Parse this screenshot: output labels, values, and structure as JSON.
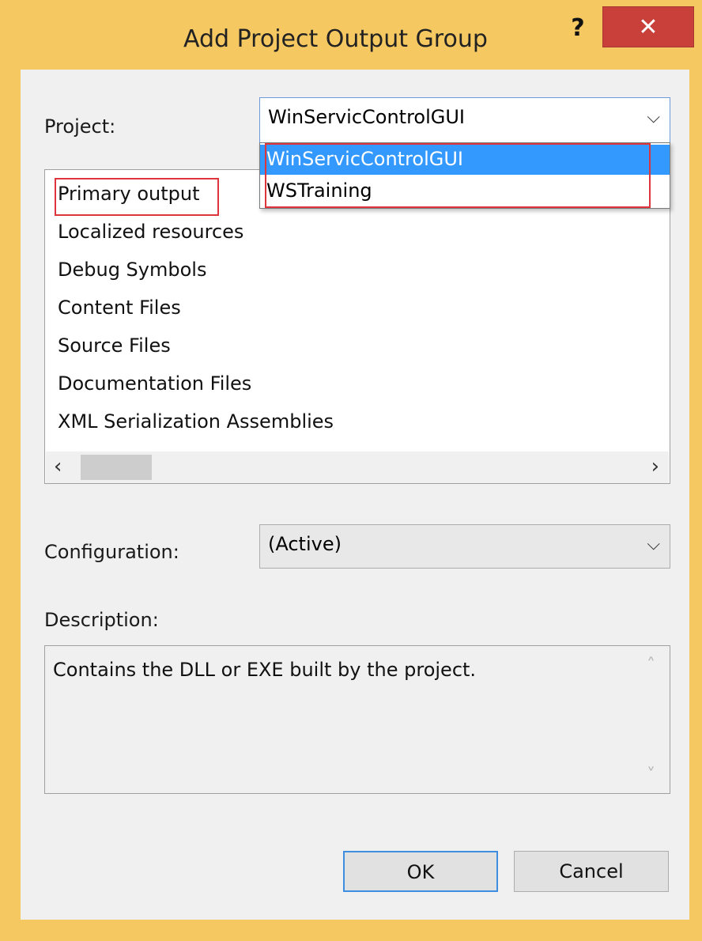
{
  "window": {
    "title": "Add Project Output Group",
    "help_label": "?",
    "close_label": "✕"
  },
  "project": {
    "label": "Project:",
    "selected": "WinServicControlGUI",
    "options": [
      "WinServicControlGUI",
      "WSTraining"
    ],
    "highlighted_index": 0
  },
  "output_list": {
    "items": [
      "Primary output",
      "Localized resources",
      "Debug Symbols",
      "Content Files",
      "Source Files",
      "Documentation Files",
      "XML Serialization Assemblies"
    ]
  },
  "configuration": {
    "label": "Configuration:",
    "selected": "(Active)"
  },
  "description": {
    "label": "Description:",
    "text": "Contains the DLL or EXE built by the project."
  },
  "buttons": {
    "ok": "OK",
    "cancel": "Cancel"
  },
  "colors": {
    "frame": "#f5c862",
    "close": "#c9403b",
    "selection": "#3399ff",
    "annotation": "#e0343c"
  },
  "icons": {
    "dropdown": "chevron-down-icon",
    "scroll_left": "chevron-left-icon",
    "scroll_right": "chevron-right-icon",
    "scroll_up": "chevron-up-icon",
    "scroll_down": "chevron-down-icon"
  }
}
